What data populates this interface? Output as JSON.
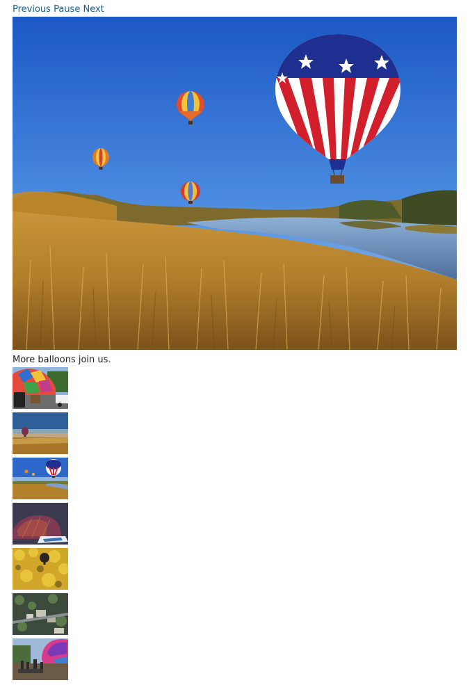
{
  "controls": {
    "previous_label": "Previous",
    "pause_label": "Pause",
    "next_label": "Next"
  },
  "slideshow": {
    "caption": "More balloons join us."
  },
  "colors": {
    "link": "#1a5c8c",
    "text": "#222222",
    "sky_top": "#1f5fc9",
    "grass": "#b8862e"
  },
  "thumbnails": [
    {
      "icon": "balloon-inflation-thumbnail-icon"
    },
    {
      "icon": "balloon-sunrise-field-thumbnail-icon"
    },
    {
      "icon": "balloon-river-thumbnail-icon"
    },
    {
      "icon": "balloon-envelope-closeup-thumbnail-icon"
    },
    {
      "icon": "balloon-over-yellow-trees-thumbnail-icon"
    },
    {
      "icon": "aerial-neighborhood-thumbnail-icon"
    },
    {
      "icon": "balloon-crowd-thumbnail-icon"
    }
  ]
}
